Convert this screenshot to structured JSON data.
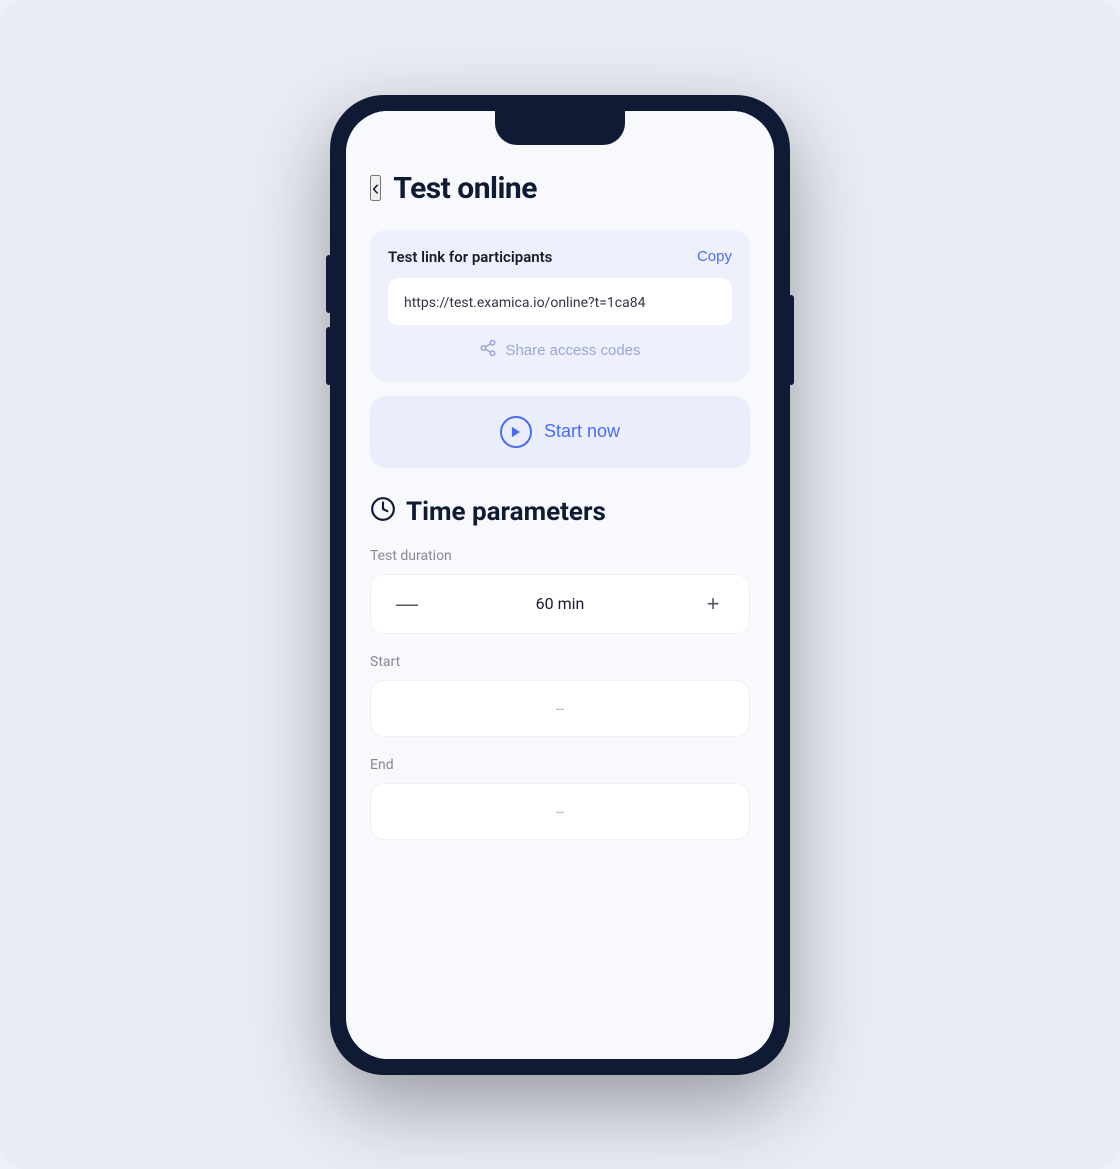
{
  "page": {
    "background_color": "#eaecf5"
  },
  "header": {
    "back_icon": "‹",
    "title": "Test online"
  },
  "test_link_card": {
    "label": "Test link for participants",
    "copy_button": "Copy",
    "url": "https://test.examica.io/online?t=1ca84",
    "share_codes_label": "Share access codes",
    "share_icon": "⤳"
  },
  "start_now_button": {
    "label": "Start now",
    "play_icon": "▶"
  },
  "time_parameters": {
    "section_title": "Time parameters",
    "clock_icon": "🕐",
    "test_duration": {
      "label": "Test duration",
      "value": "60 min",
      "decrement": "—",
      "increment": "+"
    },
    "start": {
      "label": "Start",
      "placeholder": "--"
    },
    "end": {
      "label": "End",
      "placeholder": "--"
    }
  }
}
